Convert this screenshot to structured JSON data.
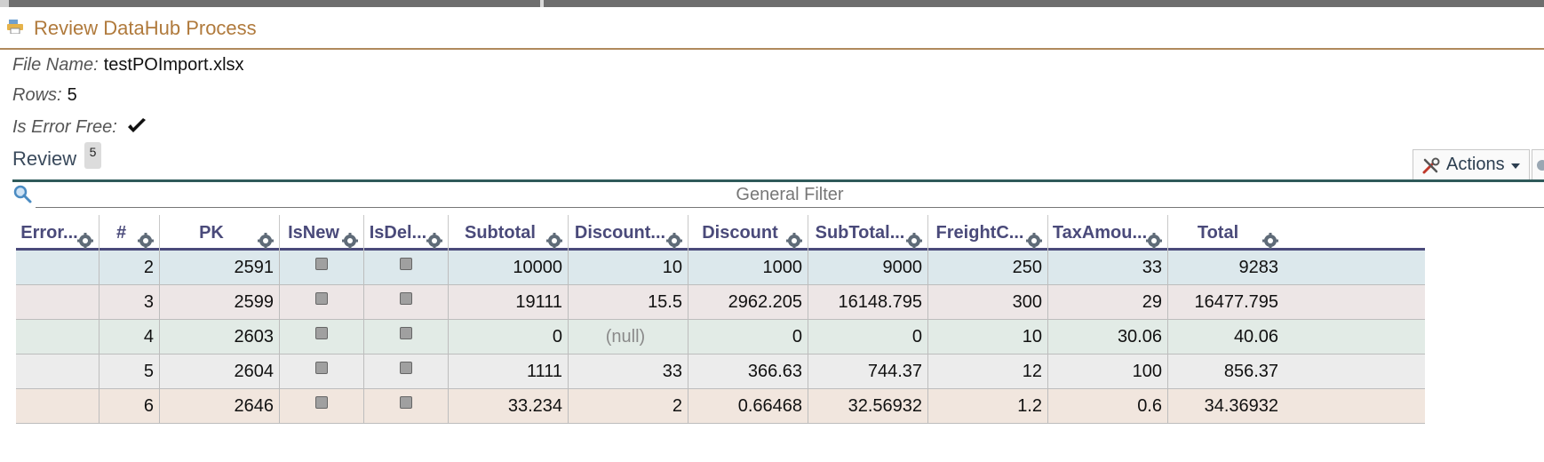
{
  "header": {
    "title": "Review DataHub Process",
    "icon": "process-icon"
  },
  "info": {
    "file_name_label": "File Name:",
    "file_name": "testPOImport.xlsx",
    "rows_label": "Rows:",
    "rows": "5",
    "error_free_label": "Is Error Free:",
    "error_free": true
  },
  "review": {
    "label": "Review",
    "count": "5"
  },
  "actions": {
    "label": "Actions"
  },
  "filter": {
    "placeholder": "General Filter"
  },
  "colors": {
    "accent": "#b07a3c",
    "header_text": "#4a4a7a",
    "row_colors": [
      "#dce8ec",
      "#ede6e6",
      "#e2ebe6",
      "#ececec",
      "#f1e6de"
    ]
  },
  "table": {
    "columns": [
      "Error...",
      "#",
      "PK",
      "IsNew",
      "IsDel...",
      "Subtotal",
      "Discount...",
      "Discount",
      "SubTotal...",
      "FreightC...",
      "TaxAmou...",
      "Total"
    ],
    "rows": [
      [
        "",
        "2",
        "2591",
        false,
        false,
        "10000",
        "10",
        "1000",
        "9000",
        "250",
        "33",
        "9283"
      ],
      [
        "",
        "3",
        "2599",
        false,
        false,
        "19111",
        "15.5",
        "2962.205",
        "16148.795",
        "300",
        "29",
        "16477.795"
      ],
      [
        "",
        "4",
        "2603",
        false,
        false,
        "0",
        "(null)",
        "0",
        "0",
        "10",
        "30.06",
        "40.06"
      ],
      [
        "",
        "5",
        "2604",
        false,
        false,
        "1111",
        "33",
        "366.63",
        "744.37",
        "12",
        "100",
        "856.37"
      ],
      [
        "",
        "6",
        "2646",
        false,
        false,
        "33.234",
        "2",
        "0.66468",
        "32.56932",
        "1.2",
        "0.6",
        "34.36932"
      ]
    ]
  }
}
